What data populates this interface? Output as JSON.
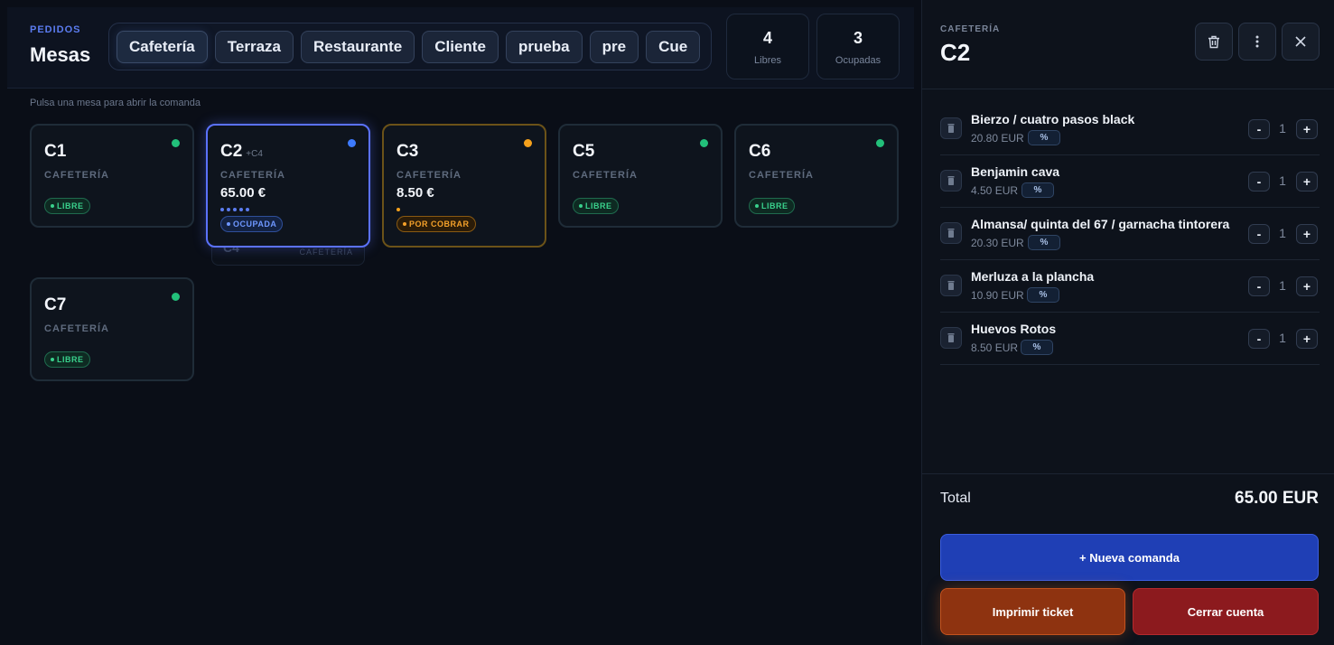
{
  "header": {
    "eyebrow": "PEDIDOS",
    "title": "Mesas",
    "tabs": [
      {
        "label": "Cafetería"
      },
      {
        "label": "Terraza"
      },
      {
        "label": "Restaurante"
      },
      {
        "label": "Cliente"
      },
      {
        "label": "prueba"
      },
      {
        "label": "pre"
      },
      {
        "label": "Cue"
      }
    ],
    "stats": {
      "free": {
        "value": "4",
        "label": "Libres"
      },
      "busy": {
        "value": "3",
        "label": "Ocupadas"
      }
    },
    "hint": "Pulsa una mesa para abrir la comanda"
  },
  "tables": [
    {
      "name": "C1",
      "area": "CAFETERÍA",
      "status": "LIBRE"
    },
    {
      "name": "C2",
      "sub": "+C4",
      "area": "CAFETERÍA",
      "amount": "65.00 €",
      "status": "OCUPADA"
    },
    {
      "name": "C3",
      "area": "CAFETERÍA",
      "amount": "8.50 €",
      "status": "POR COBRAR"
    },
    {
      "name": "C5",
      "area": "CAFETERÍA",
      "status": "LIBRE"
    },
    {
      "name": "C6",
      "area": "CAFETERÍA",
      "status": "LIBRE"
    },
    {
      "name": "C7",
      "area": "CAFETERÍA",
      "status": "LIBRE"
    }
  ],
  "ghost": {
    "name": "C4",
    "area": "CAFETERÍA"
  },
  "colors": {
    "free": "#39d18c",
    "busy": "#5b7cf0",
    "pay": "#f4a12a"
  },
  "panel": {
    "eyebrow": "CAFETERÍA",
    "title": "C2",
    "icons": [
      "trash-icon",
      "more-vertical-icon",
      "close-icon"
    ],
    "items": [
      {
        "name": "Bierzo / cuatro pasos black",
        "price": "20.80 EUR",
        "qty": "1"
      },
      {
        "name": "Benjamin cava",
        "price": "4.50 EUR",
        "qty": "1"
      },
      {
        "name": "Almansa/ quinta del 67 / garnacha tintorera",
        "price": "20.30 EUR",
        "qty": "1"
      },
      {
        "name": "Merluza a la plancha",
        "price": "10.90 EUR",
        "qty": "1"
      },
      {
        "name": "Huevos Rotos",
        "price": "8.50 EUR",
        "qty": "1"
      }
    ],
    "pct_label": "%",
    "minus_label": "-",
    "plus_label": "+",
    "total_label": "Total",
    "total_value": "65.00 EUR",
    "new_order": "+ Nueva comanda",
    "print_ticket": "Imprimir ticket",
    "close_account": "Cerrar cuenta"
  }
}
